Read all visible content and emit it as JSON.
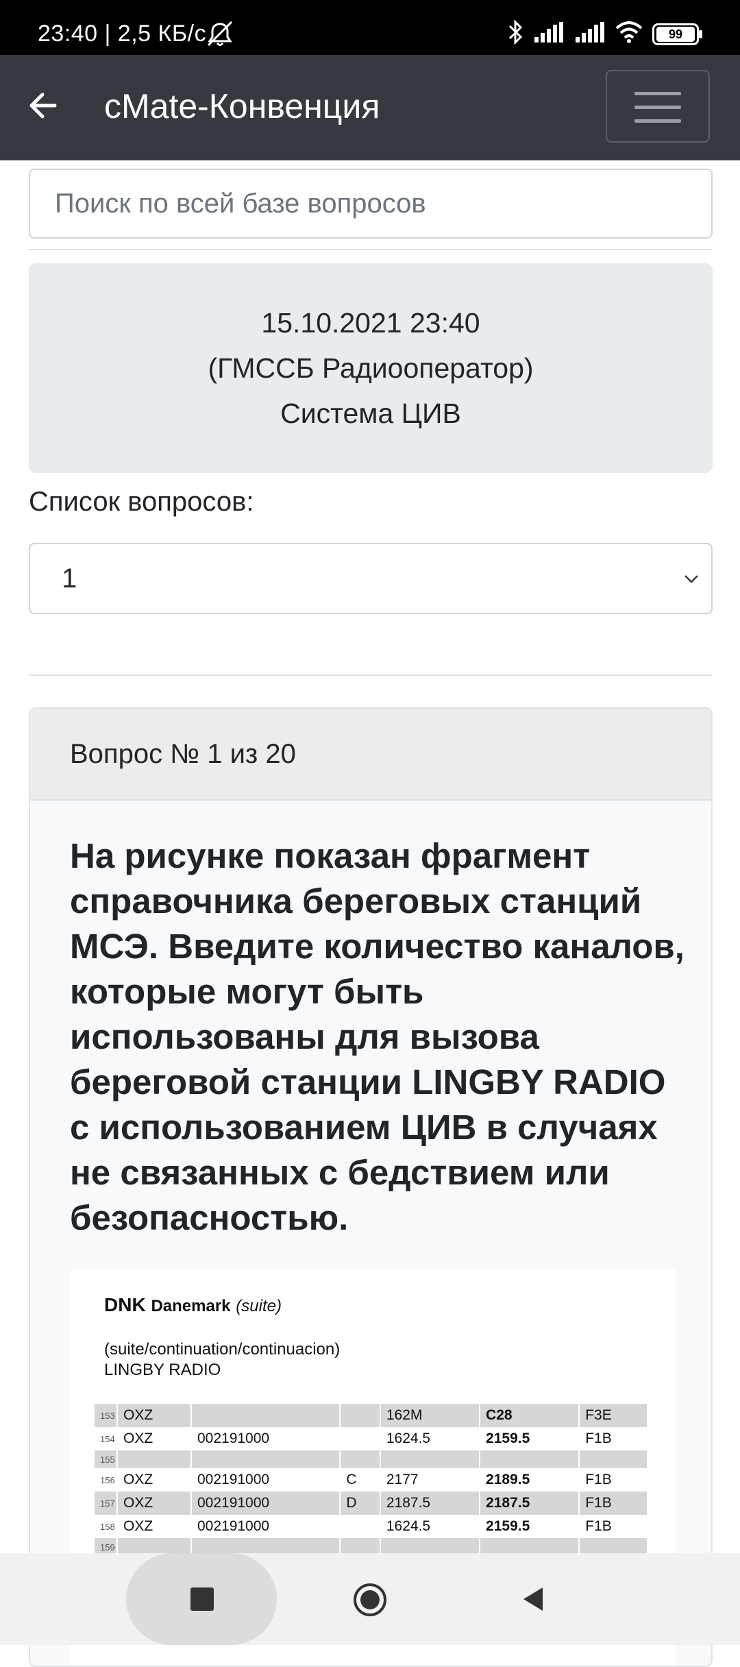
{
  "status_bar": {
    "time": "23:40 | 2,5 КБ/с",
    "battery": "99"
  },
  "app_bar": {
    "title": "cMate-Конвенция"
  },
  "search": {
    "placeholder": "Поиск по всей базе вопросов"
  },
  "info": {
    "datetime": "15.10.2021 23:40",
    "category": "(ГМССБ Радиооператор)",
    "topic": "Система ЦИВ"
  },
  "questions_list": {
    "label": "Список вопросов:",
    "selected": "1"
  },
  "question": {
    "header": "Вопрос № 1 из 20",
    "text": "На рисунке показан фрагмент справочника береговых станций МСЭ. Введите количество каналов, которые могут быть использованы для вызова береговой станции LINGBY RADIO с использованием ЦИВ в случаях не связанных с бедствием или безопасностью."
  },
  "reference_image": {
    "country_code": "DNK",
    "country": "Danemark",
    "suffix": "(suite)",
    "continuation": "(suite/continuation/continuacion)",
    "station": "LINGBY RADIO",
    "rows": [
      {
        "n": "153",
        "call": "OXZ",
        "mmsi": "",
        "flag": "",
        "rx": "162M",
        "tx": "C28",
        "cls": "F3E",
        "shade": true
      },
      {
        "n": "154",
        "call": "OXZ",
        "mmsi": "002191000",
        "flag": "",
        "rx": "1624.5",
        "tx": "2159.5",
        "cls": "F1B",
        "shade": false
      },
      {
        "n": "155",
        "call": "",
        "mmsi": "",
        "flag": "",
        "rx": "",
        "tx": "",
        "cls": "",
        "shade": true
      },
      {
        "n": "156",
        "call": "OXZ",
        "mmsi": "002191000",
        "flag": "C",
        "rx": "2177",
        "tx": "2189.5",
        "cls": "F1B",
        "shade": false
      },
      {
        "n": "157",
        "call": "OXZ",
        "mmsi": "002191000",
        "flag": "D",
        "rx": "2187.5",
        "tx": "2187.5",
        "cls": "F1B",
        "shade": true
      },
      {
        "n": "158",
        "call": "OXZ",
        "mmsi": "002191000",
        "flag": "",
        "rx": "1624.5",
        "tx": "2159.5",
        "cls": "F1B",
        "shade": false
      },
      {
        "n": "159",
        "call": "",
        "mmsi": "",
        "flag": "",
        "rx": "",
        "tx": "",
        "cls": "",
        "shade": true
      }
    ]
  }
}
